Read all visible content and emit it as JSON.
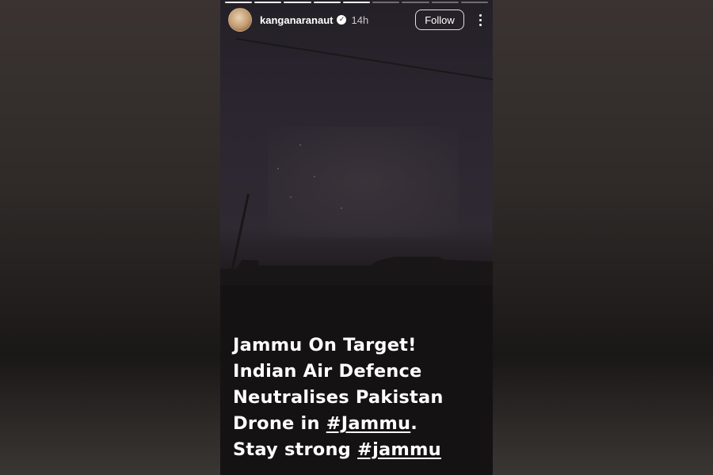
{
  "story": {
    "progress_segments": 9,
    "progress_done": 5,
    "header": {
      "username": "kanganaranaut",
      "verified_icon": "verified-badge-icon",
      "time_ago": "14h",
      "follow_label": "Follow",
      "more_icon": "more-vertical-icon"
    },
    "caption": {
      "line1": "Jammu On Target!",
      "line2": "Indian Air Defence",
      "line3": "Neutralises Pakistan",
      "line4_text": "Drone in ",
      "line4_hashtag": "#Jammu",
      "line4_suffix": ".",
      "line5_text": "Stay strong ",
      "line5_hashtag": "#jammu"
    }
  },
  "colors": {
    "text": "#ffffff",
    "background": "#2a2624"
  }
}
